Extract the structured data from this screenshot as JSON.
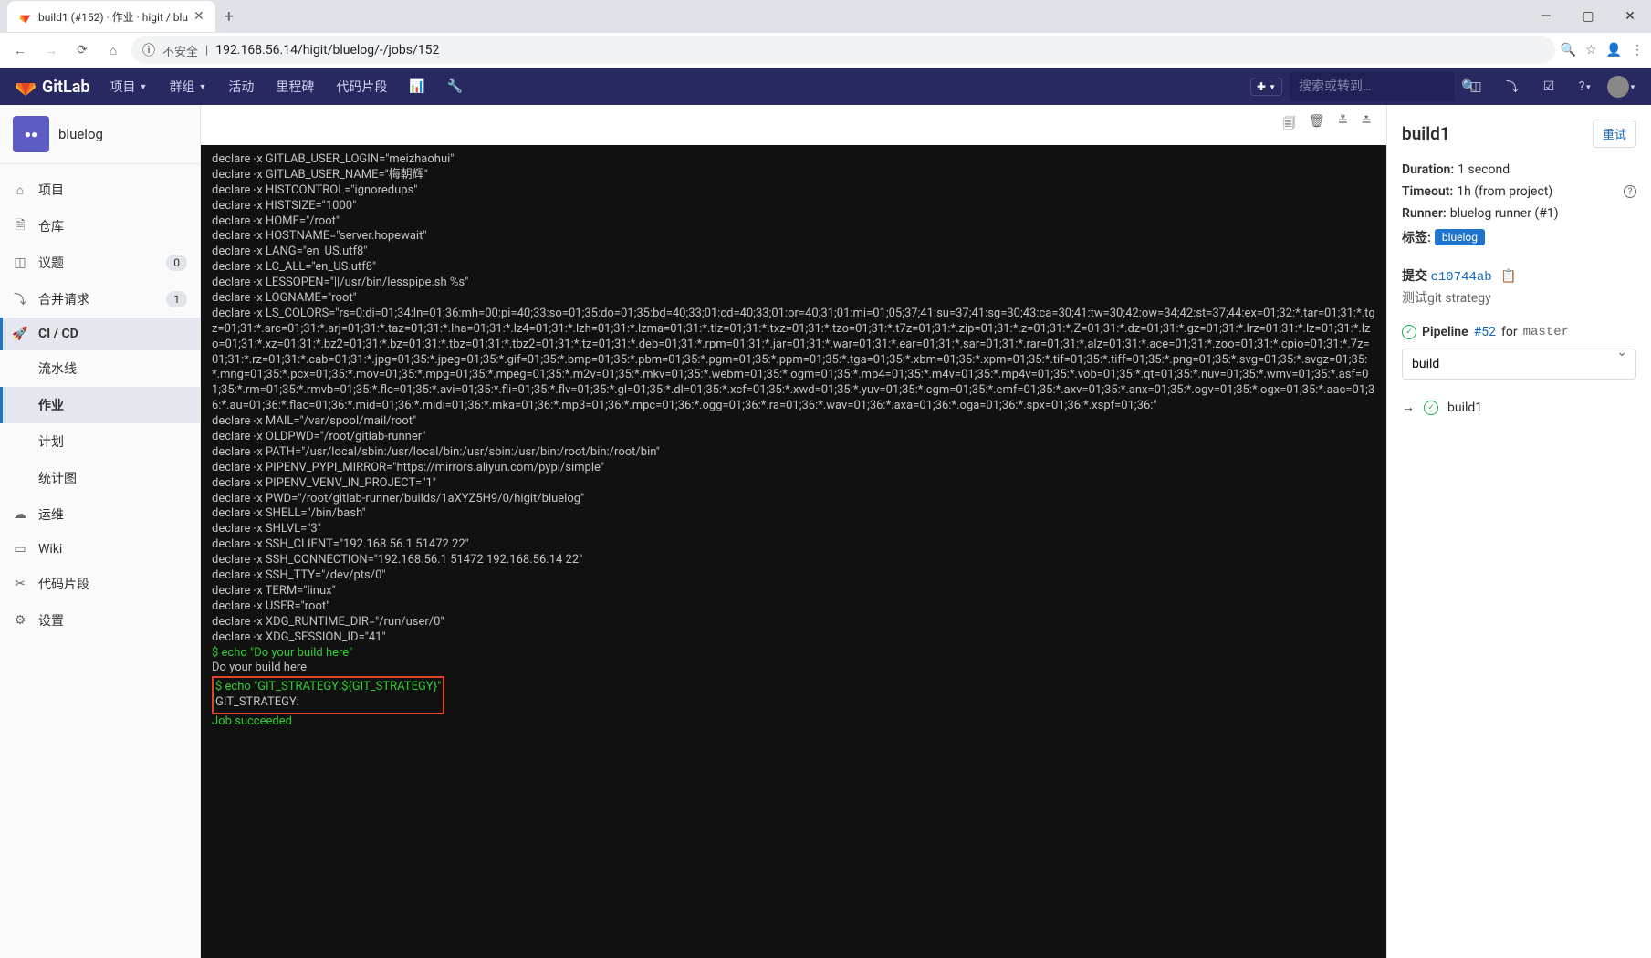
{
  "browser": {
    "tab_title": "build1 (#152) · 作业 · higit / blu",
    "insecure_label": "不安全",
    "url": "192.168.56.14/higit/bluelog/-/jobs/152"
  },
  "header": {
    "brand": "GitLab",
    "nav": [
      "项目",
      "群组",
      "活动",
      "里程碑",
      "代码片段"
    ],
    "search_placeholder": "搜索或转到…"
  },
  "sidebar": {
    "project": "bluelog",
    "items": {
      "project": "项目",
      "repo": "仓库",
      "issues": "议题",
      "issues_count": "0",
      "mr": "合并请求",
      "mr_count": "1",
      "cicd": "CI / CD",
      "pipelines": "流水线",
      "jobs": "作业",
      "schedules": "计划",
      "charts": "统计图",
      "ops": "运维",
      "wiki": "Wiki",
      "snippets": "代码片段",
      "settings": "设置"
    }
  },
  "log": {
    "lines": [
      "declare -x GITLAB_USER_LOGIN=\"meizhaohui\"",
      "declare -x GITLAB_USER_NAME=\"梅朝辉\"",
      "declare -x HISTCONTROL=\"ignoredups\"",
      "declare -x HISTSIZE=\"1000\"",
      "declare -x HOME=\"/root\"",
      "declare -x HOSTNAME=\"server.hopewait\"",
      "declare -x LANG=\"en_US.utf8\"",
      "declare -x LC_ALL=\"en_US.utf8\"",
      "declare -x LESSOPEN=\"||/usr/bin/lesspipe.sh %s\"",
      "declare -x LOGNAME=\"root\"",
      "declare -x LS_COLORS=\"rs=0:di=01;34:ln=01;36:mh=00:pi=40;33:so=01;35:do=01;35:bd=40;33;01:cd=40;33;01:or=40;31;01:mi=01;05;37;41:su=37;41:sg=30;43:ca=30;41:tw=30;42:ow=34;42:st=37;44:ex=01;32:*.tar=01;31:*.tgz=01;31:*.arc=01;31:*.arj=01;31:*.taz=01;31:*.lha=01;31:*.lz4=01;31:*.lzh=01;31:*.lzma=01;31:*.tlz=01;31:*.txz=01;31:*.tzo=01;31:*.t7z=01;31:*.zip=01;31:*.z=01;31:*.Z=01;31:*.dz=01;31:*.gz=01;31:*.lrz=01;31:*.lz=01;31:*.lzo=01;31:*.xz=01;31:*.bz2=01;31:*.bz=01;31:*.tbz=01;31:*.tbz2=01;31:*.tz=01;31:*.deb=01;31:*.rpm=01;31:*.jar=01;31:*.war=01;31:*.ear=01;31:*.sar=01;31:*.rar=01;31:*.alz=01;31:*.ace=01;31:*.zoo=01;31:*.cpio=01;31:*.7z=01;31:*.rz=01;31:*.cab=01;31:*.jpg=01;35:*.jpeg=01;35:*.gif=01;35:*.bmp=01;35:*.pbm=01;35:*.pgm=01;35:*.ppm=01;35:*.tga=01;35:*.xbm=01;35:*.xpm=01;35:*.tif=01;35:*.tiff=01;35:*.png=01;35:*.svg=01;35:*.svgz=01;35:*.mng=01;35:*.pcx=01;35:*.mov=01;35:*.mpg=01;35:*.mpeg=01;35:*.m2v=01;35:*.mkv=01;35:*.webm=01;35:*.ogm=01;35:*.mp4=01;35:*.m4v=01;35:*.mp4v=01;35:*.vob=01;35:*.qt=01;35:*.nuv=01;35:*.wmv=01;35:*.asf=01;35:*.rm=01;35:*.rmvb=01;35:*.flc=01;35:*.avi=01;35:*.fli=01;35:*.flv=01;35:*.gl=01;35:*.dl=01;35:*.xcf=01;35:*.xwd=01;35:*.yuv=01;35:*.cgm=01;35:*.emf=01;35:*.axv=01;35:*.anx=01;35:*.ogv=01;35:*.ogx=01;35:*.aac=01;36:*.au=01;36:*.flac=01;36:*.mid=01;36:*.midi=01;36:*.mka=01;36:*.mp3=01;36:*.mpc=01;36:*.ogg=01;36:*.ra=01;36:*.wav=01;36:*.axa=01;36:*.oga=01;36:*.spx=01;36:*.xspf=01;36:\"",
      "declare -x MAIL=\"/var/spool/mail/root\"",
      "declare -x OLDPWD=\"/root/gitlab-runner\"",
      "declare -x PATH=\"/usr/local/sbin:/usr/local/bin:/usr/sbin:/usr/bin:/root/bin:/root/bin\"",
      "declare -x PIPENV_PYPI_MIRROR=\"https://mirrors.aliyun.com/pypi/simple\"",
      "declare -x PIPENV_VENV_IN_PROJECT=\"1\"",
      "declare -x PWD=\"/root/gitlab-runner/builds/1aXYZ5H9/0/higit/bluelog\"",
      "declare -x SHELL=\"/bin/bash\"",
      "declare -x SHLVL=\"3\"",
      "declare -x SSH_CLIENT=\"192.168.56.1 51472 22\"",
      "declare -x SSH_CONNECTION=\"192.168.56.1 51472 192.168.56.14 22\"",
      "declare -x SSH_TTY=\"/dev/pts/0\"",
      "declare -x TERM=\"linux\"",
      "declare -x USER=\"root\"",
      "declare -x XDG_RUNTIME_DIR=\"/run/user/0\"",
      "declare -x XDG_SESSION_ID=\"41\""
    ],
    "cmd1": "$ echo \"Do your build here\"",
    "out1": "Do your build here",
    "cmd2": "$ echo \"GIT_STRATEGY:${GIT_STRATEGY}\"",
    "out2": "GIT_STRATEGY:",
    "succeeded": "Job succeeded"
  },
  "details": {
    "title": "build1",
    "retry": "重试",
    "duration_label": "Duration:",
    "duration_value": "1 second",
    "timeout_label": "Timeout:",
    "timeout_value": "1h (from project)",
    "runner_label": "Runner:",
    "runner_value": "bluelog runner (#1)",
    "tags_label": "标签:",
    "tag": "bluelog",
    "commit_label": "提交",
    "commit_sha": "c10744ab",
    "commit_msg": "测试git strategy",
    "pipeline_label": "Pipeline",
    "pipeline_num": "#52",
    "pipeline_for": "for",
    "pipeline_branch": "master",
    "stage": "build",
    "job_name": "build1"
  }
}
